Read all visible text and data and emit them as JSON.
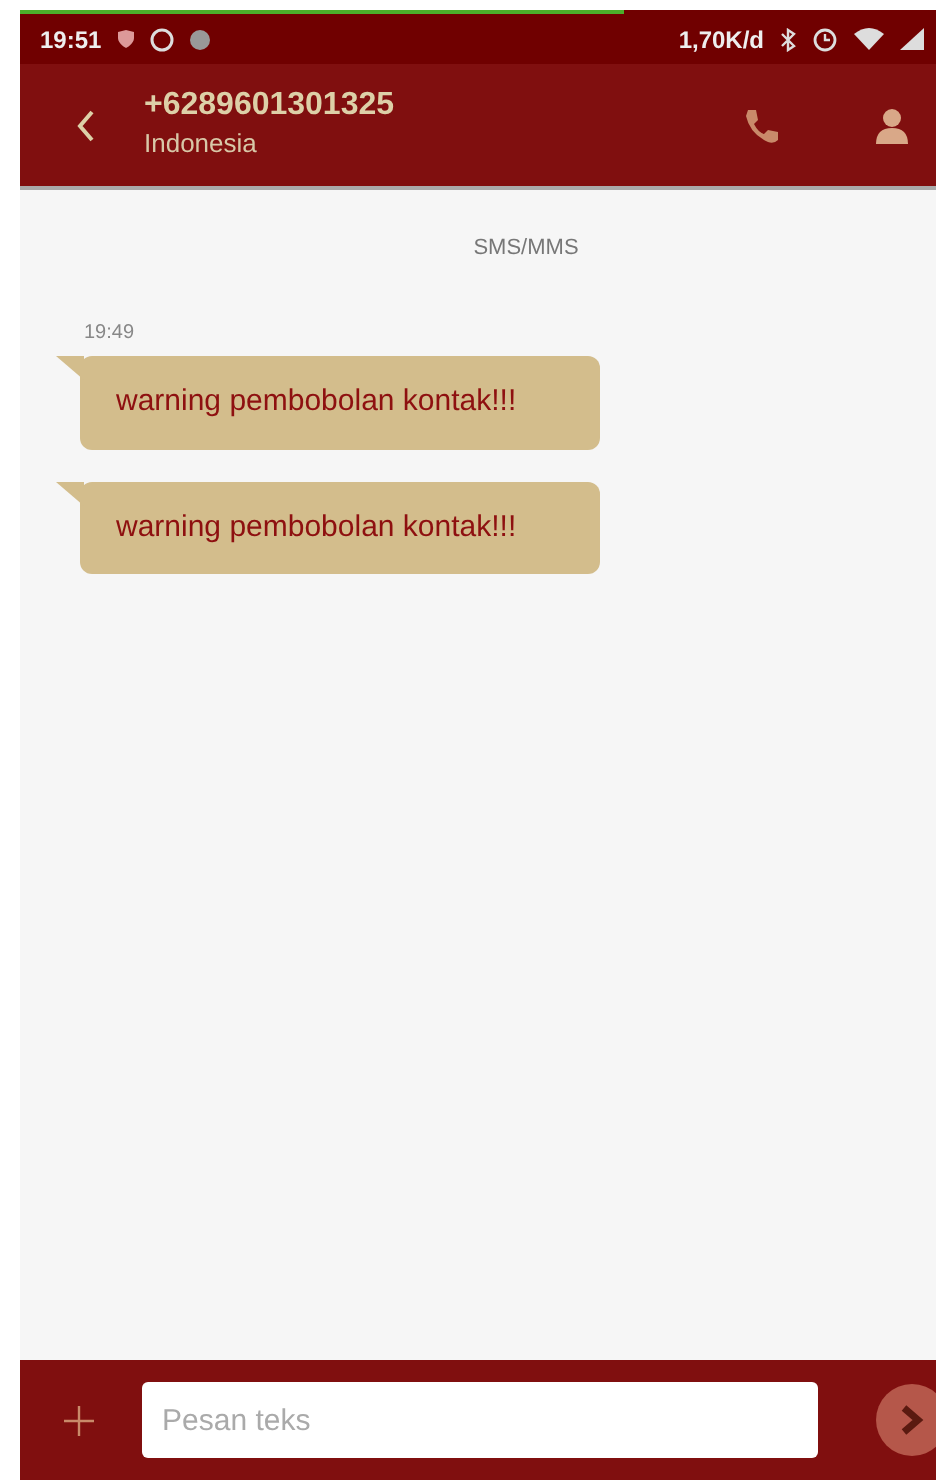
{
  "load_bar": {
    "level": 0.66
  },
  "status_bar": {
    "time": "19:51",
    "speed": "1,70K/d"
  },
  "header": {
    "title": "+6289601301325",
    "subtitle": "Indonesia"
  },
  "thread": {
    "channel": "SMS/MMS",
    "timestamp": "19:49",
    "messages": [
      {
        "text": "warning pembobolan kontak!!!"
      },
      {
        "text": "warning pembobolan kontak!!!"
      }
    ]
  },
  "composer": {
    "placeholder": "Pesan teks"
  }
}
